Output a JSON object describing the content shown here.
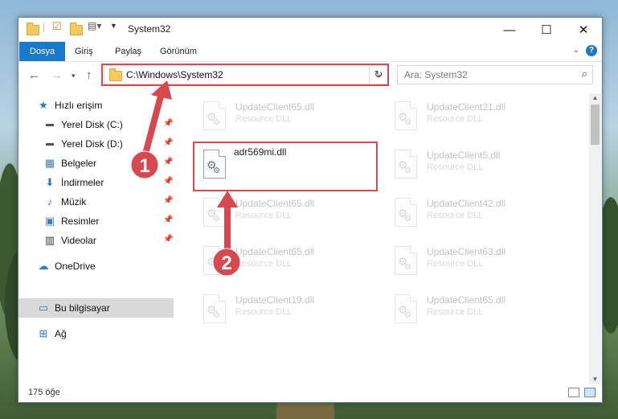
{
  "window": {
    "title": "System32",
    "minimize_icon": "minimize-icon",
    "maximize_icon": "maximize-icon",
    "close_icon": "close-icon"
  },
  "ribbon": {
    "tabs": [
      {
        "label": "Dosya"
      },
      {
        "label": "Giriş"
      },
      {
        "label": "Paylaş"
      },
      {
        "label": "Görünüm"
      }
    ],
    "help_label": "?"
  },
  "nav": {
    "address_path": "C:\\Windows\\System32",
    "search_placeholder": "Ara: System32"
  },
  "sidebar": {
    "items": [
      {
        "label": "Hızlı erişim",
        "icon": "star-icon"
      },
      {
        "label": "Yerel Disk (C:)",
        "icon": "drive-icon"
      },
      {
        "label": "Yerel Disk (D:)",
        "icon": "drive-icon"
      },
      {
        "label": "Belgeler",
        "icon": "documents-icon"
      },
      {
        "label": "İndirmeler",
        "icon": "download-icon"
      },
      {
        "label": "Müzik",
        "icon": "music-icon"
      },
      {
        "label": "Resimler",
        "icon": "pictures-icon"
      },
      {
        "label": "Videolar",
        "icon": "videos-icon"
      },
      {
        "label": "OneDrive",
        "icon": "cloud-icon"
      },
      {
        "label": "Bu bilgisayar",
        "icon": "computer-icon"
      },
      {
        "label": "Ağ",
        "icon": "network-icon"
      }
    ]
  },
  "files": [
    {
      "name": "UpdateClient65.dll",
      "type": "Resource DLL"
    },
    {
      "name": "UpdateClient21.dll",
      "type": "Resource DLL"
    },
    {
      "name": "adr569mi.dll",
      "type": ""
    },
    {
      "name": "UpdateClient5.dll",
      "type": "Resource DLL"
    },
    {
      "name": "UpdateClient65.dll",
      "type": "Resource DLL"
    },
    {
      "name": "UpdateClient42.dll",
      "type": "Resource DLL"
    },
    {
      "name": "UpdateClient65.dll",
      "type": "Resource DLL"
    },
    {
      "name": "UpdateClient63.dll",
      "type": "Resource DLL"
    },
    {
      "name": "UpdateClient19.dll",
      "type": "Resource DLL"
    },
    {
      "name": "UpdateClient65.dll",
      "type": "Resource DLL"
    }
  ],
  "status": {
    "item_count": "175 öğe"
  },
  "annotations": {
    "step1": "1",
    "step2": "2",
    "highlight_color": "#d9474f"
  }
}
